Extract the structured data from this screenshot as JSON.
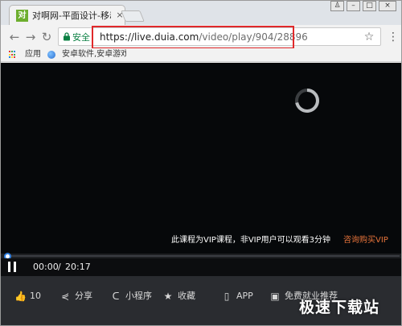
{
  "browser": {
    "tab": {
      "favicon_text": "对",
      "title": "对啊网-平面设计-移动UI",
      "close_glyph": "×"
    },
    "window_controls": {
      "user": "♙",
      "minimize": "–",
      "maximize": "□",
      "close": "×"
    },
    "nav": {
      "back": "←",
      "forward": "→",
      "reload": "↻"
    },
    "omnibox": {
      "secure_label": "安全",
      "url_host": "https://live.duia.com",
      "url_path": "/video/play/904/28896",
      "bookmark_glyph": "☆",
      "menu_glyph": "⋮"
    },
    "bookmarks": {
      "apps_label": "应用",
      "site_label": "安卓软件,安卓游戏,"
    }
  },
  "player": {
    "vip_message": "此课程为VIP课程，非VIP用户可以观看3分钟",
    "vip_link": "咨询购买VIP",
    "time_current": "00:00",
    "time_separator": "/",
    "time_total": "20:17",
    "progress_fraction": 0.0
  },
  "actions": [
    {
      "icon": "thumbs-up-icon",
      "glyph": "👍",
      "label": "10"
    },
    {
      "icon": "share-icon",
      "glyph": "⋞",
      "label": "分享"
    },
    {
      "icon": "mini-program-icon",
      "glyph": "ᑕ",
      "label": "小程序"
    },
    {
      "icon": "star-icon",
      "glyph": "★",
      "label": "收藏"
    },
    {
      "icon": "phone-icon",
      "glyph": "▯",
      "label": "APP"
    },
    {
      "icon": "briefcase-icon",
      "glyph": "▣",
      "label": "免费就业推荐"
    }
  ],
  "watermark": "极速下载站",
  "colors": {
    "secure": "#0b8043",
    "highlight_box": "#e0292b",
    "vip_link": "#e8743b",
    "progress": "#2f7fe0"
  }
}
